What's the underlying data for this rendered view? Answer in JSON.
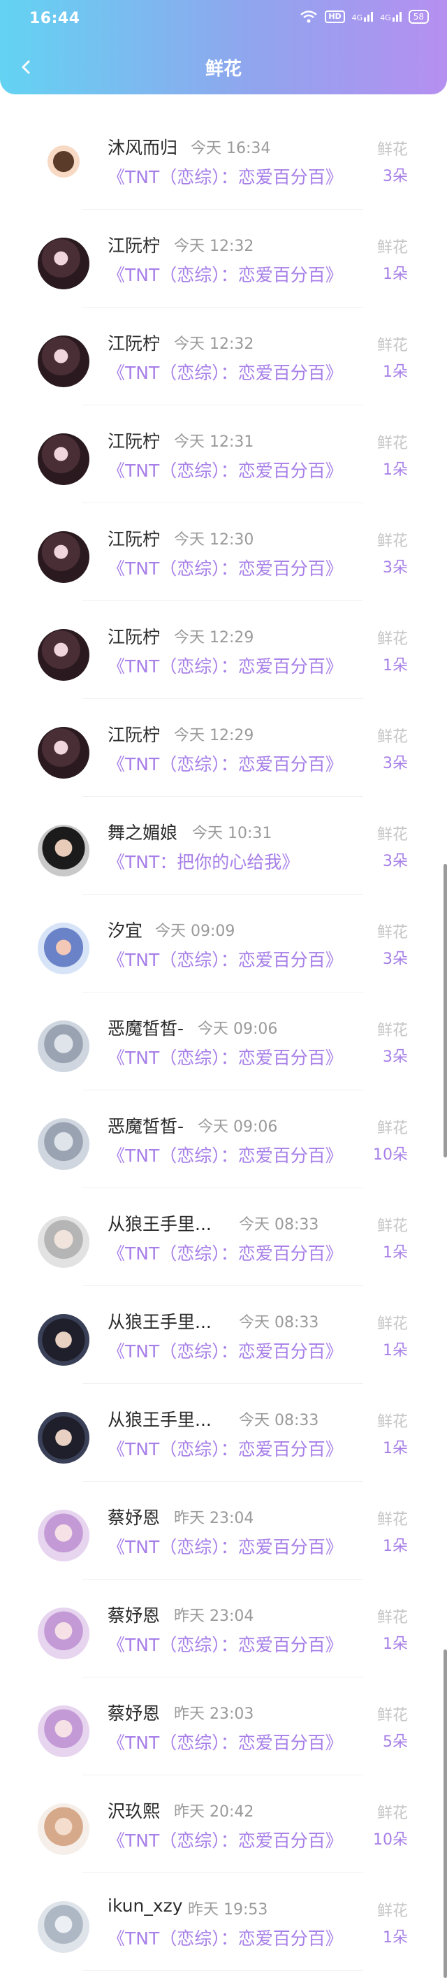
{
  "status": {
    "time": "16:44",
    "hd": "HD",
    "signal1": "4G",
    "signal2": "4G",
    "battery": "58"
  },
  "header": {
    "title": "鲜花"
  },
  "items": [
    {
      "name": "沐风而归",
      "time": "今天 16:34",
      "book": "《TNT（恋综）：恋爱百分百》",
      "gift": "鲜花",
      "count": "3朵",
      "avatar": "cartoon"
    },
    {
      "name": "江阮柠",
      "time": "今天 12:32",
      "book": "《TNT（恋综）：恋爱百分百》",
      "gift": "鲜花",
      "count": "1朵",
      "avatar": "dark"
    },
    {
      "name": "江阮柠",
      "time": "今天 12:32",
      "book": "《TNT（恋综）：恋爱百分百》",
      "gift": "鲜花",
      "count": "1朵",
      "avatar": "dark"
    },
    {
      "name": "江阮柠",
      "time": "今天 12:31",
      "book": "《TNT（恋综）：恋爱百分百》",
      "gift": "鲜花",
      "count": "1朵",
      "avatar": "dark"
    },
    {
      "name": "江阮柠",
      "time": "今天 12:30",
      "book": "《TNT（恋综）：恋爱百分百》",
      "gift": "鲜花",
      "count": "3朵",
      "avatar": "dark"
    },
    {
      "name": "江阮柠",
      "time": "今天 12:29",
      "book": "《TNT（恋综）：恋爱百分百》",
      "gift": "鲜花",
      "count": "1朵",
      "avatar": "dark"
    },
    {
      "name": "江阮柠",
      "time": "今天 12:29",
      "book": "《TNT（恋综）：恋爱百分百》",
      "gift": "鲜花",
      "count": "3朵",
      "avatar": "dark"
    },
    {
      "name": "舞之媚娘",
      "time": "今天 10:31",
      "book": "《TNT：把你的心给我》",
      "gift": "鲜花",
      "count": "3朵",
      "avatar": "boy"
    },
    {
      "name": "汐宜",
      "time": "今天 09:09",
      "book": "《TNT（恋综）：恋爱百分百》",
      "gift": "鲜花",
      "count": "3朵",
      "avatar": "blue"
    },
    {
      "name": "恶魔皙皙-",
      "time": "今天 09:06",
      "book": "《TNT（恋综）：恋爱百分百》",
      "gift": "鲜花",
      "count": "3朵",
      "avatar": "grey"
    },
    {
      "name": "恶魔皙皙-",
      "time": "今天 09:06",
      "book": "《TNT（恋综）：恋爱百分百》",
      "gift": "鲜花",
      "count": "10朵",
      "avatar": "grey"
    },
    {
      "name": "从狼王手里...",
      "time": "今天 08:33",
      "book": "《TNT（恋综）：恋爱百分百》",
      "gift": "鲜花",
      "count": "1朵",
      "avatar": "light"
    },
    {
      "name": "从狼王手里...",
      "time": "今天 08:33",
      "book": "《TNT（恋综）：恋爱百分百》",
      "gift": "鲜花",
      "count": "1朵",
      "avatar": "boy2"
    },
    {
      "name": "从狼王手里...",
      "time": "今天 08:33",
      "book": "《TNT（恋综）：恋爱百分百》",
      "gift": "鲜花",
      "count": "1朵",
      "avatar": "boy2"
    },
    {
      "name": "蔡妤恩",
      "time": "昨天 23:04",
      "book": "《TNT（恋综）：恋爱百分百》",
      "gift": "鲜花",
      "count": "1朵",
      "avatar": "pink"
    },
    {
      "name": "蔡妤恩",
      "time": "昨天 23:04",
      "book": "《TNT（恋综）：恋爱百分百》",
      "gift": "鲜花",
      "count": "1朵",
      "avatar": "pink"
    },
    {
      "name": "蔡妤恩",
      "time": "昨天 23:03",
      "book": "《TNT（恋综）：恋爱百分百》",
      "gift": "鲜花",
      "count": "5朵",
      "avatar": "pink"
    },
    {
      "name": "沢玖熙",
      "time": "昨天 20:42",
      "book": "《TNT（恋综）：恋爱百分百》",
      "gift": "鲜花",
      "count": "10朵",
      "avatar": "warm"
    },
    {
      "name": "ikun_xzy",
      "time": "昨天 19:53",
      "book": "《TNT（恋综）：恋爱百分百》",
      "gift": "鲜花",
      "count": "1朵",
      "avatar": "pale"
    }
  ],
  "colors": {
    "accent": "#a77fe8",
    "header_start": "#63d3f2",
    "header_end": "#b58ff0"
  }
}
